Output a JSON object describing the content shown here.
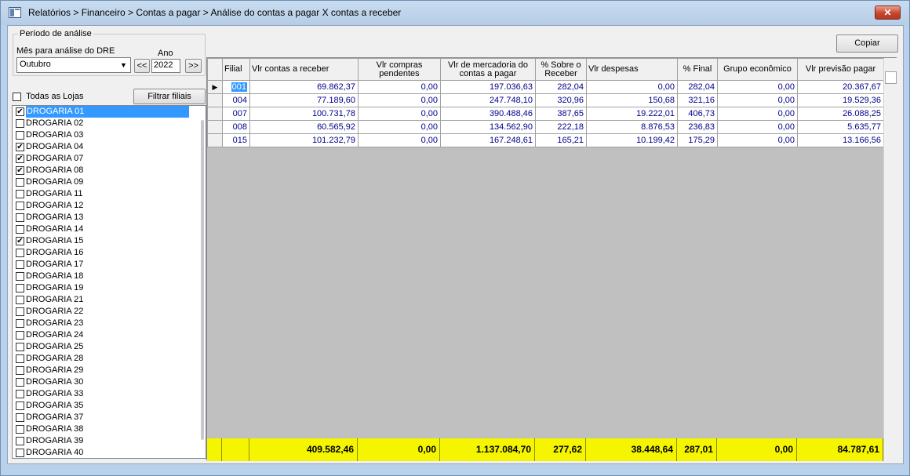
{
  "window": {
    "title": "Relatórios > Financeiro > Contas a pagar > Análise do contas a pagar X contas a receber",
    "close_label": "✕"
  },
  "periodo": {
    "legend": "Período de análise",
    "mes_label": "Mês para análise do DRE",
    "mes_value": "Outubro",
    "ano_label": "Ano",
    "ano_value": "2022",
    "prev_label": "<<",
    "next_label": ">>"
  },
  "filtros": {
    "todas_label": "Todas as Lojas",
    "todas_checked": false,
    "filtrar_label": "Filtrar filiais"
  },
  "copiar_label": "Copiar",
  "stores": [
    {
      "name": "DROGARIA 01",
      "checked": true,
      "selected": true
    },
    {
      "name": "DROGARIA 02",
      "checked": false
    },
    {
      "name": "DROGARIA 03",
      "checked": false
    },
    {
      "name": "DROGARIA 04",
      "checked": true
    },
    {
      "name": "DROGARIA 07",
      "checked": true
    },
    {
      "name": "DROGARIA 08",
      "checked": true
    },
    {
      "name": "DROGARIA 09",
      "checked": false
    },
    {
      "name": "DROGARIA 11",
      "checked": false
    },
    {
      "name": "DROGARIA 12",
      "checked": false
    },
    {
      "name": "DROGARIA 13",
      "checked": false
    },
    {
      "name": "DROGARIA 14",
      "checked": false
    },
    {
      "name": "DROGARIA 15",
      "checked": true
    },
    {
      "name": "DROGARIA 16",
      "checked": false
    },
    {
      "name": "DROGARIA 17",
      "checked": false
    },
    {
      "name": "DROGARIA 18",
      "checked": false
    },
    {
      "name": "DROGARIA 19",
      "checked": false
    },
    {
      "name": "DROGARIA 21",
      "checked": false
    },
    {
      "name": "DROGARIA 22",
      "checked": false
    },
    {
      "name": "DROGARIA 23",
      "checked": false
    },
    {
      "name": "DROGARIA 24",
      "checked": false
    },
    {
      "name": "DROGARIA 25",
      "checked": false
    },
    {
      "name": "DROGARIA 28",
      "checked": false
    },
    {
      "name": "DROGARIA 29",
      "checked": false
    },
    {
      "name": "DROGARIA 30",
      "checked": false
    },
    {
      "name": "DROGARIA 33",
      "checked": false
    },
    {
      "name": "DROGARIA 35",
      "checked": false
    },
    {
      "name": "DROGARIA 37",
      "checked": false
    },
    {
      "name": "DROGARIA 38",
      "checked": false
    },
    {
      "name": "DROGARIA 39",
      "checked": false
    },
    {
      "name": "DROGARIA 40",
      "checked": false
    }
  ],
  "grid": {
    "columns": [
      "Filial",
      "Vlr contas a receber",
      "Vlr compras pendentes",
      "Vlr de mercadoria do contas a pagar",
      "% Sobre o Receber",
      "Vlr despesas",
      "% Final",
      "Grupo econômico",
      "Vlr previsão pagar"
    ],
    "rows": [
      [
        "001",
        "69.862,37",
        "0,00",
        "197.036,63",
        "282,04",
        "0,00",
        "282,04",
        "0,00",
        "20.367,67"
      ],
      [
        "004",
        "77.189,60",
        "0,00",
        "247.748,10",
        "320,96",
        "150,68",
        "321,16",
        "0,00",
        "19.529,36"
      ],
      [
        "007",
        "100.731,78",
        "0,00",
        "390.488,46",
        "387,65",
        "19.222,01",
        "406,73",
        "0,00",
        "26.088,25"
      ],
      [
        "008",
        "60.565,92",
        "0,00",
        "134.562,90",
        "222,18",
        "8.876,53",
        "236,83",
        "0,00",
        "5.635,77"
      ],
      [
        "015",
        "101.232,79",
        "0,00",
        "167.248,61",
        "165,21",
        "10.199,42",
        "175,29",
        "0,00",
        "13.166,56"
      ]
    ],
    "totals": [
      "409.582,46",
      "0,00",
      "1.137.084,70",
      "277,62",
      "38.448,64",
      "287,01",
      "0,00",
      "84.787,61"
    ],
    "row_indicator": "▶"
  }
}
